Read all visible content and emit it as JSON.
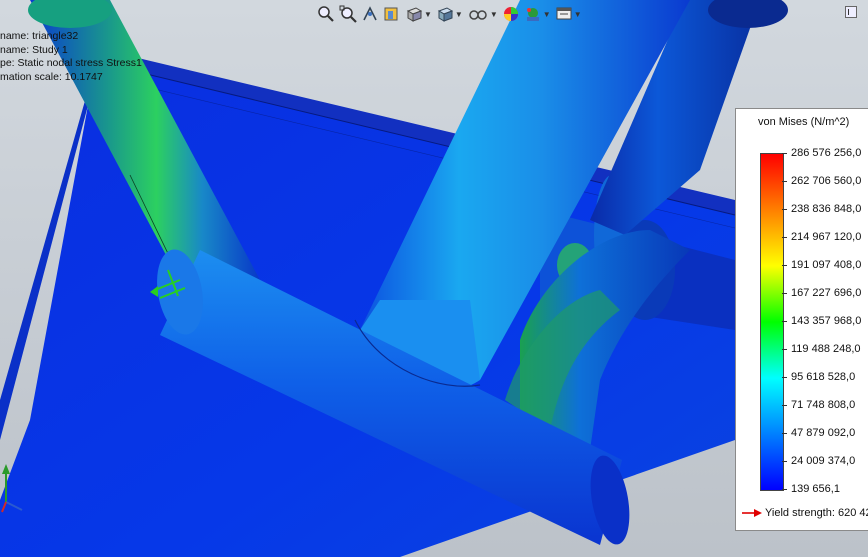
{
  "info_lines": [
    "name: triangle32",
    "name: Study 1",
    "pe: Static nodal stress Stress1",
    "mation scale: 10.1747"
  ],
  "toolbar": {
    "items": [
      {
        "icon": "zoom-to-fit-icon",
        "dropdown": false
      },
      {
        "icon": "zoom-to-area-icon",
        "dropdown": false
      },
      {
        "icon": "previous-view-icon",
        "dropdown": false
      },
      {
        "icon": "section-view-icon",
        "dropdown": false
      },
      {
        "icon": "view-orientation-icon",
        "dropdown": true
      },
      {
        "icon": "display-style-icon",
        "dropdown": true
      },
      {
        "icon": "hide-show-items-icon",
        "dropdown": true
      },
      {
        "icon": "edit-appearance-icon",
        "dropdown": false
      },
      {
        "icon": "apply-scene-icon",
        "dropdown": true
      },
      {
        "icon": "view-settings-icon",
        "dropdown": true
      }
    ]
  },
  "legend": {
    "title": "von Mises (N/m^2)",
    "ticks": [
      "286 576 256,0",
      "262 706 560,0",
      "238 836 848,0",
      "214 967 120,0",
      "191 097 408,0",
      "167 227 696,0",
      "143 357 968,0",
      "119 488 248,0",
      "95 618 528,0",
      "71 748 808,0",
      "47 879 092,0",
      "24 009 374,0",
      "139 656,1"
    ],
    "colormap": [
      "#ff0000",
      "#ff8000",
      "#ffff00",
      "#00ff00",
      "#00ffff",
      "#0080ff",
      "#0000ff"
    ],
    "yield_label": "Yield strength: 620 42",
    "yield_arrow_color": "#e00000"
  },
  "colors": {
    "background": "#c9cfd6",
    "plate": "#0a2fd8",
    "tube_low": "#1060ff",
    "tube_mid": "#1cc0ff",
    "hotspot": "#33d633"
  }
}
